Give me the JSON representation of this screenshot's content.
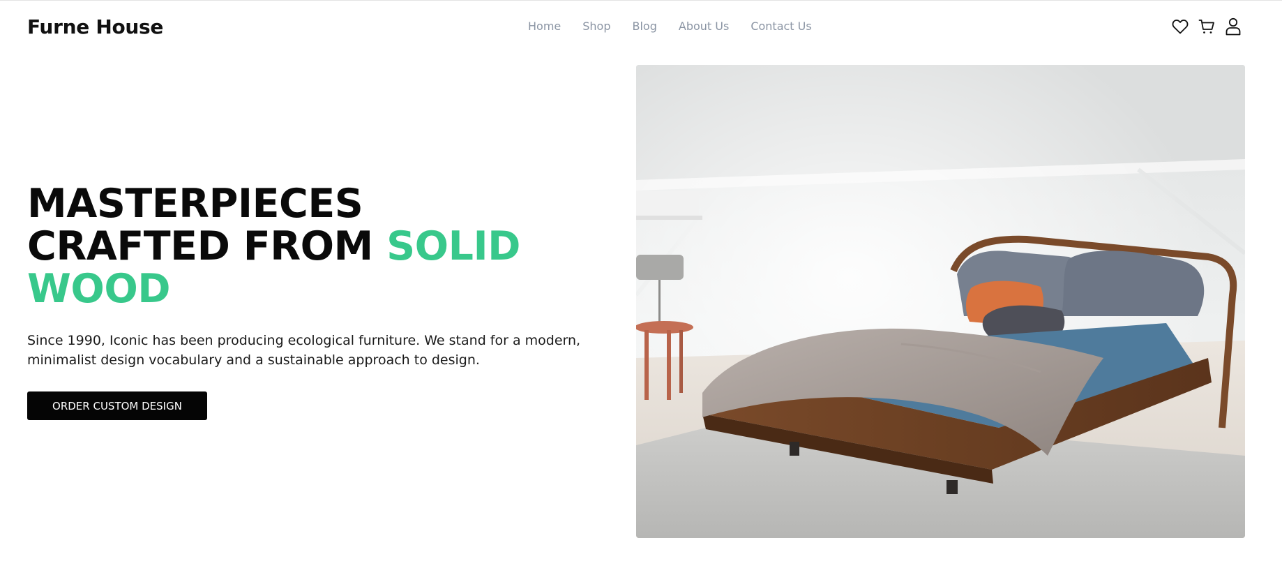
{
  "brand": {
    "name": "Furne House"
  },
  "nav": {
    "items": [
      {
        "label": "Home"
      },
      {
        "label": "Shop"
      },
      {
        "label": "Blog"
      },
      {
        "label": "About Us"
      },
      {
        "label": "Contact Us"
      }
    ]
  },
  "header_icons": [
    "heart-icon",
    "cart-icon",
    "user-icon"
  ],
  "hero": {
    "title_line1": "MASTERPIECES",
    "title_line2": "CRAFTED FROM",
    "title_accent1": "SOLID",
    "title_accent2": "WOOD",
    "description": "Since 1990, Iconic has been producing ecological furniture. We stand for a modern, minimalist design vocabulary and a sustainable approach to design.",
    "cta_label": "ORDER CUSTOM DESIGN"
  },
  "colors": {
    "accent": "#38c88b",
    "nav_text": "#8a94a3",
    "button_bg": "#050505",
    "text": "#111111"
  }
}
